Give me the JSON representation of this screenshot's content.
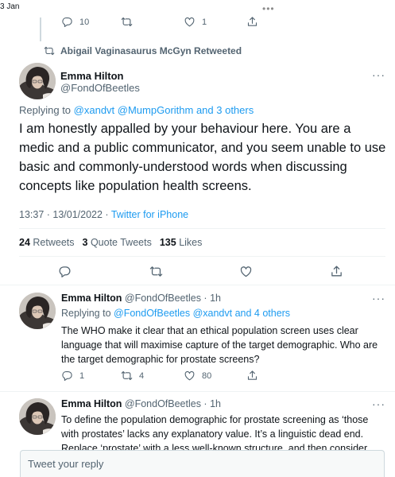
{
  "window": {
    "date_peek": "3 Jan",
    "dots": "•••"
  },
  "prev_tweet": {
    "reply_count": "10",
    "retweet_count": "",
    "like_count": "1"
  },
  "retweet_context": {
    "label": "Abigail Vaginasaurus McGyn Retweeted"
  },
  "main_tweet": {
    "name": "Emma Hilton",
    "handle": "@FondOfBeetles",
    "replying_prefix": "Replying to",
    "replying_targets": "@xandvt @MumpGorithm and 3 others",
    "text": "I am honestly appalled by your behaviour here. You are a medic and a public communicator, and you seem unable to use basic and commonly-understood words when discussing concepts like population health screens.",
    "time": "13:37 · 13/01/2022 · ",
    "source": "Twitter for iPhone",
    "retweets_count": "24",
    "retweets_label": "Retweets",
    "quotes_count": "3",
    "quotes_label": "Quote Tweets",
    "likes_count": "135",
    "likes_label": "Likes"
  },
  "replies": [
    {
      "name": "Emma Hilton",
      "handle_time": "@FondOfBeetles · 1h",
      "replying_prefix": "Replying to",
      "replying_targets": "@FondOfBeetles @xandvt and 4 others",
      "text": "The WHO make it clear that an ethical population screen uses clear language that will maximise capture of the target demographic. Who are the target demographic for prostate screens?",
      "reply_count": "1",
      "retweet_count": "4",
      "like_count": "80"
    },
    {
      "name": "Emma Hilton",
      "handle_time": "@FondOfBeetles · 1h",
      "text": "To define the population demographic for prostate screening as ‘those with prostates’ lacks any explanatory value. It’s a linguistic dead end. Replace ‘prostate’ with a less well-known structure, and then consider"
    }
  ],
  "compose": {
    "placeholder": "Tweet your reply"
  },
  "icons": {
    "reply": "reply-icon",
    "retweet": "retweet-icon",
    "like": "heart-icon",
    "share": "share-icon",
    "more": "more-icon"
  },
  "colors": {
    "accent": "#1d9bf0",
    "text": "#0f1419",
    "muted": "#536471",
    "divider": "#eff3f4"
  }
}
